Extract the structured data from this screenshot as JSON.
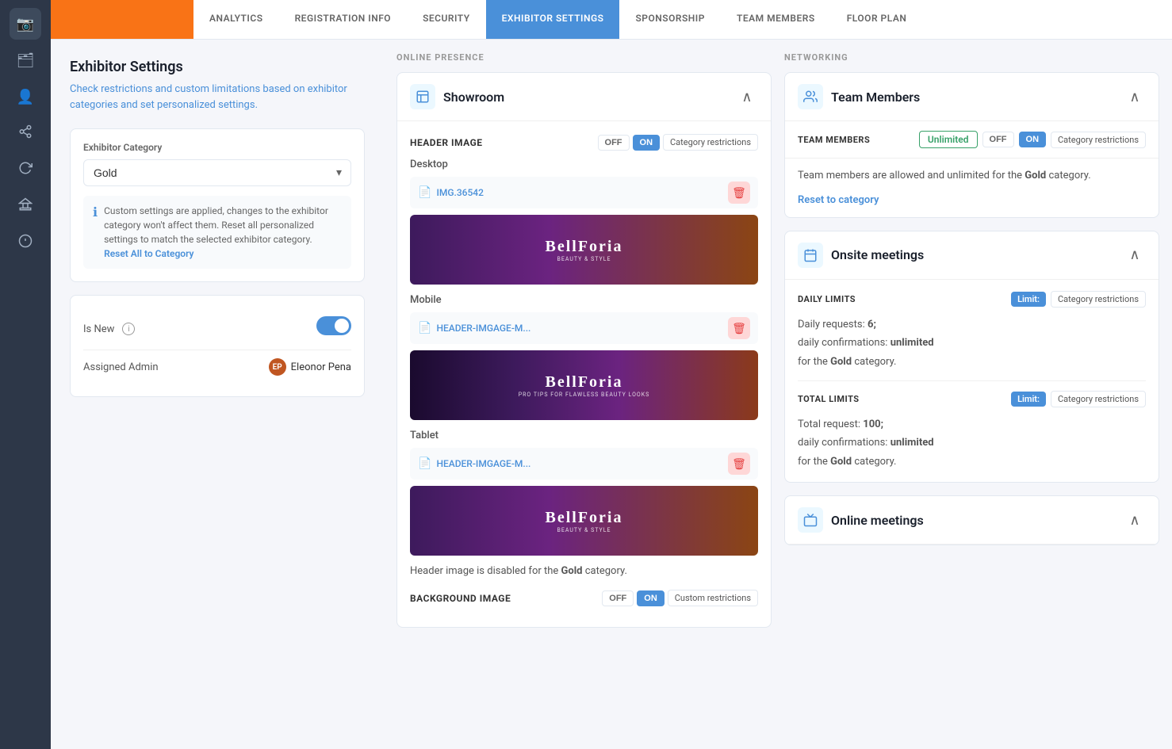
{
  "sidebar": {
    "icons": [
      {
        "name": "camera-icon",
        "symbol": "📷",
        "active": true
      },
      {
        "name": "briefcase-icon",
        "symbol": "💼",
        "active": false
      },
      {
        "name": "users-icon",
        "symbol": "👥",
        "active": false
      },
      {
        "name": "share-icon",
        "symbol": "↗",
        "active": false
      },
      {
        "name": "refresh-icon",
        "symbol": "↻",
        "active": false
      },
      {
        "name": "monument-icon",
        "symbol": "🏛",
        "active": false
      },
      {
        "name": "info-icon",
        "symbol": "ℹ",
        "active": false
      }
    ]
  },
  "topNav": {
    "tabs": [
      {
        "id": "analytics",
        "label": "ANALYTICS",
        "active": false
      },
      {
        "id": "registration-info",
        "label": "REGISTRATION INFO",
        "active": false
      },
      {
        "id": "security",
        "label": "SECURITY",
        "active": false
      },
      {
        "id": "exhibitor-settings",
        "label": "EXHIBITOR SETTINGS",
        "active": true
      },
      {
        "id": "sponsorship",
        "label": "SPONSORSHIP",
        "active": false
      },
      {
        "id": "team-members",
        "label": "TEAM MEMBERS",
        "active": false
      },
      {
        "id": "floor-plan",
        "label": "FLOOR PLAN",
        "active": false
      }
    ]
  },
  "leftPanel": {
    "title": "Exhibitor Settings",
    "description": "Check restrictions and custom limitations based on exhibitor categories and set personalized settings.",
    "categoryLabel": "Exhibitor Category",
    "categoryValue": "Gold",
    "infoText": "Custom settings are applied, changes to the exhibitor category won't affect them. Reset all personalized settings to match the selected exhibitor category.",
    "resetLink": "Reset All to Category",
    "isNewLabel": "Is New",
    "assignedAdminLabel": "Assigned Admin",
    "adminName": "Eleonor Pena"
  },
  "onlinePresence": {
    "sectionLabel": "ONLINE PRESENCE",
    "showroom": {
      "title": "Showroom",
      "headerImage": {
        "label": "HEADER IMAGE",
        "offLabel": "OFF",
        "onLabel": "ON",
        "restrictionLabel": "Category restrictions"
      },
      "desktop": {
        "deviceLabel": "Desktop",
        "fileName": "IMG.36542"
      },
      "mobile": {
        "deviceLabel": "Mobile",
        "fileName": "HEADER-IMGAGE-M..."
      },
      "tablet": {
        "deviceLabel": "Tablet",
        "fileName": "HEADER-IMGAGE-M..."
      },
      "disabledNotice": "Header image is disabled for the",
      "disabledCategory": "Gold",
      "disabledSuffix": "category.",
      "backgroundImageLabel": "BACKGROUND IMAGE",
      "bgOffLabel": "OFF",
      "bgOnLabel": "ON",
      "bgRestrictionLabel": "Custom restrictions"
    }
  },
  "networking": {
    "sectionLabel": "NETWORKING",
    "teamMembers": {
      "title": "Team Members",
      "rowLabel": "TEAM MEMBERS",
      "unlimitedLabel": "Unlimited",
      "offLabel": "OFF",
      "onLabel": "ON",
      "restrictionLabel": "Category restrictions",
      "infoText1": "Team members are allowed and unlimited for the",
      "boldCategory": "Gold",
      "infoText2": "category.",
      "resetLink": "Reset to category"
    },
    "onsiteMeetings": {
      "title": "Onsite meetings",
      "dailyLimits": {
        "label": "DAILY LIMITS",
        "limitLabel": "Limit:",
        "restrictionLabel": "Category restrictions"
      },
      "dailyDetails": {
        "text1": "Daily requests:",
        "requests": "6;",
        "text2": "daily confirmations:",
        "confirmations": "unlimited",
        "text3": "for the",
        "category": "Gold",
        "text4": "category."
      },
      "totalLimits": {
        "label": "TOTAL LIMITS",
        "limitLabel": "Limit:",
        "restrictionLabel": "Category restrictions"
      },
      "totalDetails": {
        "text1": "Total request:",
        "requests": "100;",
        "text2": "daily confirmations:",
        "confirmations": "unlimited",
        "text3": "for the",
        "category": "Gold",
        "text4": "category."
      }
    },
    "onlineMeetings": {
      "title": "Online meetings"
    }
  }
}
